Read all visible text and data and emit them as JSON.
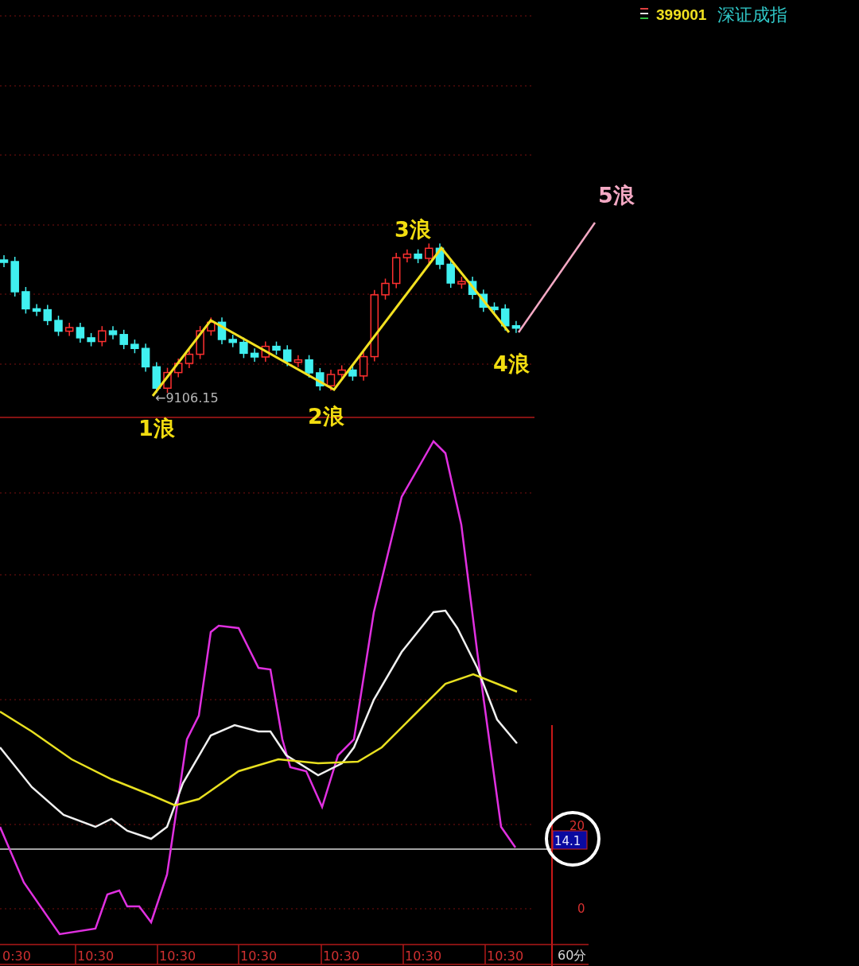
{
  "header": {
    "code": "399001",
    "name": "深证成指"
  },
  "price_chart": {
    "low_label": "←9106.15",
    "wave_labels": [
      {
        "text": "1浪",
        "color": "#f2dd10"
      },
      {
        "text": "2浪",
        "color": "#f2dd10"
      },
      {
        "text": "3浪",
        "color": "#f2dd10"
      },
      {
        "text": "4浪",
        "color": "#f2dd10"
      },
      {
        "text": "5浪",
        "color": "#f4a9c4"
      }
    ]
  },
  "indicator": {
    "y_labels": [
      "20",
      "0"
    ],
    "value_badge": "14.1"
  },
  "time_axis": {
    "labels": [
      "0:30",
      "10:30",
      "10:30",
      "10:30",
      "10:30",
      "10:30",
      "10:30"
    ],
    "period": "60分"
  }
}
